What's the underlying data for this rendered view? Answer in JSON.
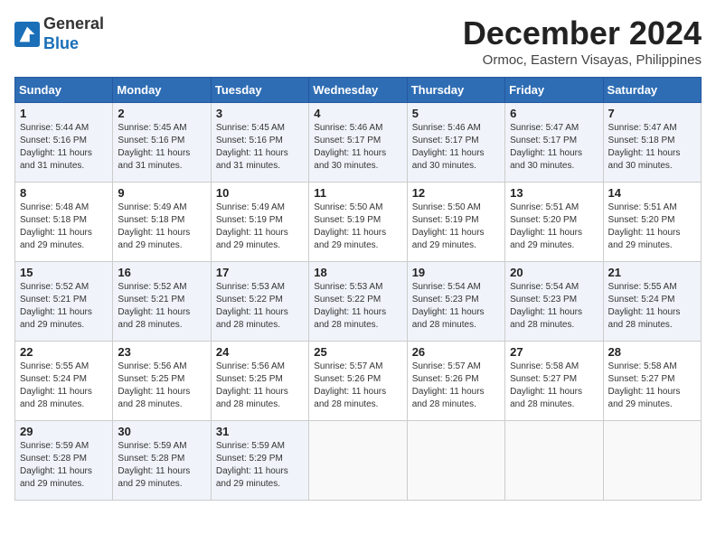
{
  "header": {
    "logo_line1": "General",
    "logo_line2": "Blue",
    "title": "December 2024",
    "location": "Ormoc, Eastern Visayas, Philippines"
  },
  "columns": [
    "Sunday",
    "Monday",
    "Tuesday",
    "Wednesday",
    "Thursday",
    "Friday",
    "Saturday"
  ],
  "weeks": [
    [
      {
        "day": "1",
        "info": "Sunrise: 5:44 AM\nSunset: 5:16 PM\nDaylight: 11 hours\nand 31 minutes."
      },
      {
        "day": "2",
        "info": "Sunrise: 5:45 AM\nSunset: 5:16 PM\nDaylight: 11 hours\nand 31 minutes."
      },
      {
        "day": "3",
        "info": "Sunrise: 5:45 AM\nSunset: 5:16 PM\nDaylight: 11 hours\nand 31 minutes."
      },
      {
        "day": "4",
        "info": "Sunrise: 5:46 AM\nSunset: 5:17 PM\nDaylight: 11 hours\nand 30 minutes."
      },
      {
        "day": "5",
        "info": "Sunrise: 5:46 AM\nSunset: 5:17 PM\nDaylight: 11 hours\nand 30 minutes."
      },
      {
        "day": "6",
        "info": "Sunrise: 5:47 AM\nSunset: 5:17 PM\nDaylight: 11 hours\nand 30 minutes."
      },
      {
        "day": "7",
        "info": "Sunrise: 5:47 AM\nSunset: 5:18 PM\nDaylight: 11 hours\nand 30 minutes."
      }
    ],
    [
      {
        "day": "8",
        "info": "Sunrise: 5:48 AM\nSunset: 5:18 PM\nDaylight: 11 hours\nand 29 minutes."
      },
      {
        "day": "9",
        "info": "Sunrise: 5:49 AM\nSunset: 5:18 PM\nDaylight: 11 hours\nand 29 minutes."
      },
      {
        "day": "10",
        "info": "Sunrise: 5:49 AM\nSunset: 5:19 PM\nDaylight: 11 hours\nand 29 minutes."
      },
      {
        "day": "11",
        "info": "Sunrise: 5:50 AM\nSunset: 5:19 PM\nDaylight: 11 hours\nand 29 minutes."
      },
      {
        "day": "12",
        "info": "Sunrise: 5:50 AM\nSunset: 5:19 PM\nDaylight: 11 hours\nand 29 minutes."
      },
      {
        "day": "13",
        "info": "Sunrise: 5:51 AM\nSunset: 5:20 PM\nDaylight: 11 hours\nand 29 minutes."
      },
      {
        "day": "14",
        "info": "Sunrise: 5:51 AM\nSunset: 5:20 PM\nDaylight: 11 hours\nand 29 minutes."
      }
    ],
    [
      {
        "day": "15",
        "info": "Sunrise: 5:52 AM\nSunset: 5:21 PM\nDaylight: 11 hours\nand 29 minutes."
      },
      {
        "day": "16",
        "info": "Sunrise: 5:52 AM\nSunset: 5:21 PM\nDaylight: 11 hours\nand 28 minutes."
      },
      {
        "day": "17",
        "info": "Sunrise: 5:53 AM\nSunset: 5:22 PM\nDaylight: 11 hours\nand 28 minutes."
      },
      {
        "day": "18",
        "info": "Sunrise: 5:53 AM\nSunset: 5:22 PM\nDaylight: 11 hours\nand 28 minutes."
      },
      {
        "day": "19",
        "info": "Sunrise: 5:54 AM\nSunset: 5:23 PM\nDaylight: 11 hours\nand 28 minutes."
      },
      {
        "day": "20",
        "info": "Sunrise: 5:54 AM\nSunset: 5:23 PM\nDaylight: 11 hours\nand 28 minutes."
      },
      {
        "day": "21",
        "info": "Sunrise: 5:55 AM\nSunset: 5:24 PM\nDaylight: 11 hours\nand 28 minutes."
      }
    ],
    [
      {
        "day": "22",
        "info": "Sunrise: 5:55 AM\nSunset: 5:24 PM\nDaylight: 11 hours\nand 28 minutes."
      },
      {
        "day": "23",
        "info": "Sunrise: 5:56 AM\nSunset: 5:25 PM\nDaylight: 11 hours\nand 28 minutes."
      },
      {
        "day": "24",
        "info": "Sunrise: 5:56 AM\nSunset: 5:25 PM\nDaylight: 11 hours\nand 28 minutes."
      },
      {
        "day": "25",
        "info": "Sunrise: 5:57 AM\nSunset: 5:26 PM\nDaylight: 11 hours\nand 28 minutes."
      },
      {
        "day": "26",
        "info": "Sunrise: 5:57 AM\nSunset: 5:26 PM\nDaylight: 11 hours\nand 28 minutes."
      },
      {
        "day": "27",
        "info": "Sunrise: 5:58 AM\nSunset: 5:27 PM\nDaylight: 11 hours\nand 28 minutes."
      },
      {
        "day": "28",
        "info": "Sunrise: 5:58 AM\nSunset: 5:27 PM\nDaylight: 11 hours\nand 29 minutes."
      }
    ],
    [
      {
        "day": "29",
        "info": "Sunrise: 5:59 AM\nSunset: 5:28 PM\nDaylight: 11 hours\nand 29 minutes."
      },
      {
        "day": "30",
        "info": "Sunrise: 5:59 AM\nSunset: 5:28 PM\nDaylight: 11 hours\nand 29 minutes."
      },
      {
        "day": "31",
        "info": "Sunrise: 5:59 AM\nSunset: 5:29 PM\nDaylight: 11 hours\nand 29 minutes."
      },
      {
        "day": "",
        "info": ""
      },
      {
        "day": "",
        "info": ""
      },
      {
        "day": "",
        "info": ""
      },
      {
        "day": "",
        "info": ""
      }
    ]
  ]
}
